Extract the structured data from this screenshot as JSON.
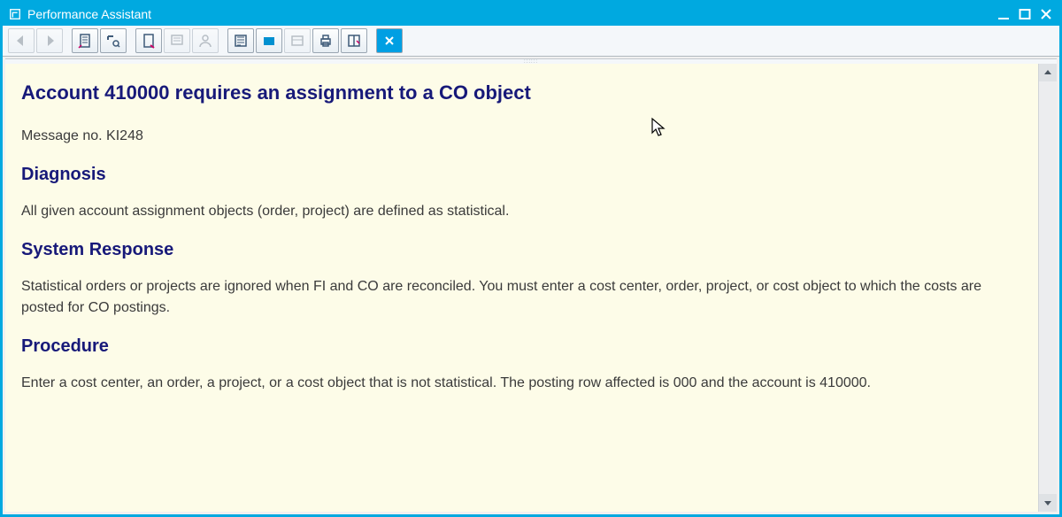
{
  "window": {
    "title": "Performance Assistant"
  },
  "content": {
    "heading": "Account 410000 requires an assignment to a CO object",
    "message_no": "Message no. KI248",
    "diagnosis_heading": "Diagnosis",
    "diagnosis_text": "All given account assignment objects (order, project) are defined as statistical.",
    "system_response_heading": "System Response",
    "system_response_text": "Statistical orders or projects are ignored when FI and CO are reconciled. You must enter a cost center, order, project, or cost object to which the costs are posted for CO postings.",
    "procedure_heading": "Procedure",
    "procedure_text": "Enter a cost center, an order, a project, or a cost object that is not statistical. The posting row affected is 000 and the account is 410000."
  },
  "toolbar": {
    "icons": [
      "back-icon",
      "forward-icon",
      "document-icon",
      "tools-icon",
      "page-icon",
      "form-icon",
      "person-icon",
      "report-icon",
      "flag-icon",
      "box-icon",
      "print-icon",
      "layout-icon",
      "close-icon"
    ]
  }
}
